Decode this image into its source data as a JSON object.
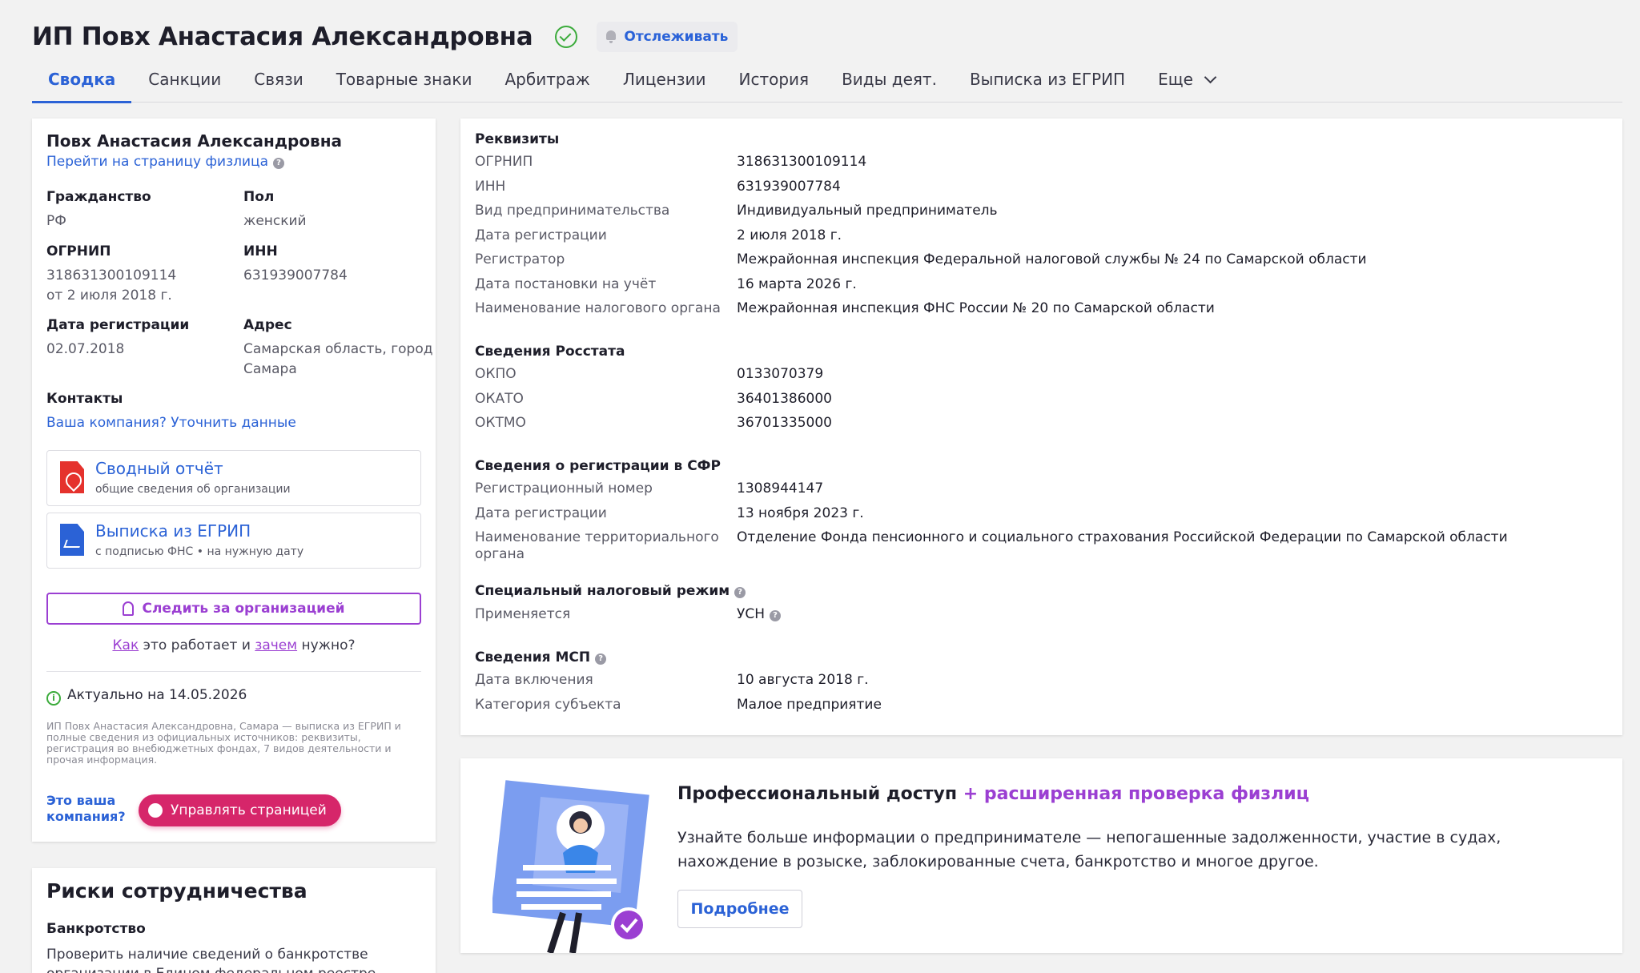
{
  "header": {
    "title": "ИП Повх Анастасия Александровна",
    "track_label": "Отслеживать"
  },
  "tabs": [
    {
      "label": "Сводка"
    },
    {
      "label": "Санкции"
    },
    {
      "label": "Связи"
    },
    {
      "label": "Товарные знаки"
    },
    {
      "label": "Арбитраж"
    },
    {
      "label": "Лицензии"
    },
    {
      "label": "История"
    },
    {
      "label": "Виды деят."
    },
    {
      "label": "Выписка из ЕГРИП"
    },
    {
      "label": "Еще"
    }
  ],
  "summary": {
    "name": "Повх Анастасия Александровна",
    "person_link": "Перейти на страницу физлица",
    "citizenship_label": "Гражданство",
    "citizenship": "РФ",
    "sex_label": "Пол",
    "sex": "женский",
    "ogrnip_label": "ОГРНИП",
    "ogrnip": "318631300109114",
    "ogrnip_date": "от 2 июля 2018 г.",
    "inn_label": "ИНН",
    "inn": "631939007784",
    "regdate_label": "Дата регистрации",
    "regdate": "02.07.2018",
    "address_label": "Адрес",
    "address_line1": "Самарская область, город",
    "address_line2": "Самара",
    "contacts_label": "Контакты",
    "contacts_link": "Ваша компания? Уточнить данные",
    "report_title": "Сводный отчёт",
    "report_sub": "общие сведения об организации",
    "extract_title": "Выписка из ЕГРИП",
    "extract_sub": "с подписью ФНС • на нужную дату",
    "follow_label": "Следить за организацией",
    "how_1": "Как",
    "how_2": " это работает и ",
    "how_3": "зачем",
    "how_4": " нужно?",
    "actual": "Актуально на 14.05.2026",
    "note": "ИП Повх Анастасия Александровна, Самара — выписка из ЕГРИП и полные сведения из официальных источников: реквизиты, регистрация во внебюджетных фондах, 7 видов деятельности и прочая информация.",
    "your_company_1": "Это ваша",
    "your_company_2": "компания?",
    "manage_label": "Управлять страницей"
  },
  "risks": {
    "title": "Риски сотрудничества",
    "bankruptcy_label": "Банкротство",
    "bankruptcy_text": "Проверить наличие сведений о банкротстве",
    "bankruptcy_text2": "организации в Едином федеральном реестре"
  },
  "requisites": {
    "sections": [
      {
        "title": "Реквизиты",
        "rows": [
          {
            "k": "ОГРНИП",
            "v": "318631300109114"
          },
          {
            "k": "ИНН",
            "v": "631939007784"
          },
          {
            "k": "Вид предпринимательства",
            "v": "Индивидуальный предприниматель"
          },
          {
            "k": "Дата регистрации",
            "v": "2 июля 2018 г."
          },
          {
            "k": "Регистратор",
            "v": "Межрайонная инспекция Федеральной налоговой службы № 24 по Самарской области"
          },
          {
            "k": "Дата постановки на учёт",
            "v": "16 марта 2026 г."
          },
          {
            "k": "Наименование налогового органа",
            "v": "Межрайонная инспекция ФНС России № 20 по Самарской области"
          }
        ]
      },
      {
        "title": "Сведения Росстата",
        "rows": [
          {
            "k": "ОКПО",
            "v": "0133070379"
          },
          {
            "k": "ОКАТО",
            "v": "36401386000"
          },
          {
            "k": "ОКТМО",
            "v": "36701335000"
          }
        ]
      },
      {
        "title": "Сведения о регистрации в СФР",
        "rows": [
          {
            "k": "Регистрационный номер",
            "v": "1308944147"
          },
          {
            "k": "Дата регистрации",
            "v": "13 ноября 2023 г."
          },
          {
            "k": "Наименование территориального",
            "k2": "органа",
            "v": "Отделение Фонда пенсионного и социального страхования Российской Федерации по Самарской области"
          }
        ]
      },
      {
        "title": "Специальный налоговый режим",
        "rows": [
          {
            "k": "Применяется",
            "v": "УСН"
          }
        ]
      },
      {
        "title": "Сведения МСП",
        "rows": [
          {
            "k": "Дата включения",
            "v": "10 августа 2018 г."
          },
          {
            "k": "Категория субъекта",
            "v": "Малое предприятие"
          }
        ]
      }
    ]
  },
  "promo": {
    "title_main": "Профессиональный доступ",
    "title_accent": "+ расширенная проверка физлиц",
    "text": "Узнайте больше информации о предпринимателе — непогашенные задолженности, участие в судах, нахождение в розыске, заблокированные счета, банкротство и многое другое.",
    "button": "Подробнее"
  },
  "colors": {
    "accent_blue": "#2b62d6",
    "accent_purple": "#9b3fd2",
    "manage_pink": "#d6266a",
    "verified_green": "#3bab3b"
  }
}
